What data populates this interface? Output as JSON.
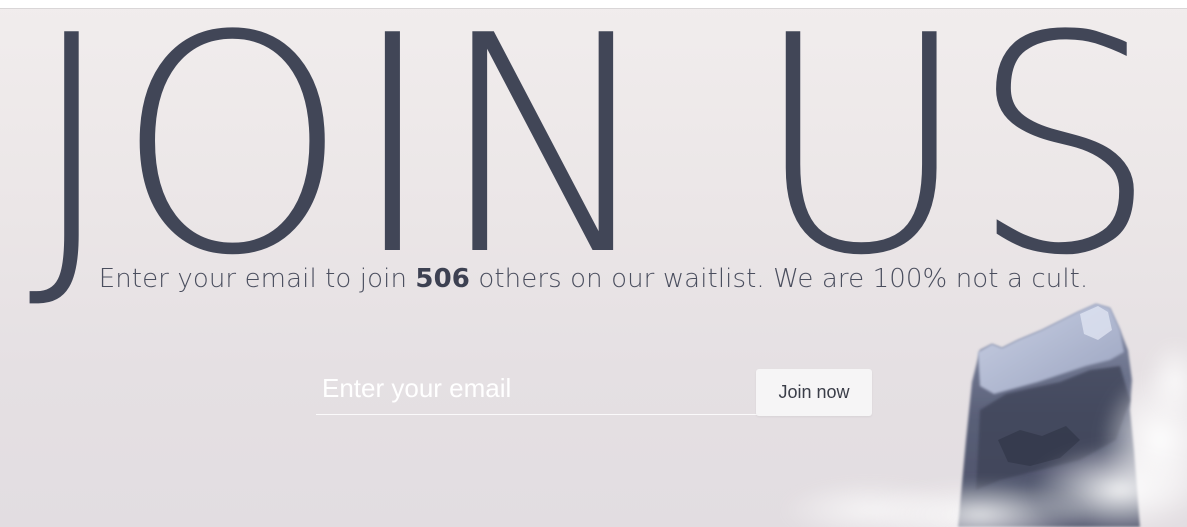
{
  "hero": {
    "title": "JOIN US"
  },
  "subtitle": {
    "prefix": "Enter your email to join ",
    "count": "506",
    "suffix": " others on our waitlist. We are 100% not a cult."
  },
  "form": {
    "email_placeholder": "Enter your email",
    "email_value": "",
    "submit_label": "Join now"
  },
  "colors": {
    "title": "#414657",
    "text": "#4a4e5e",
    "button_bg": "#f6f5f6"
  }
}
